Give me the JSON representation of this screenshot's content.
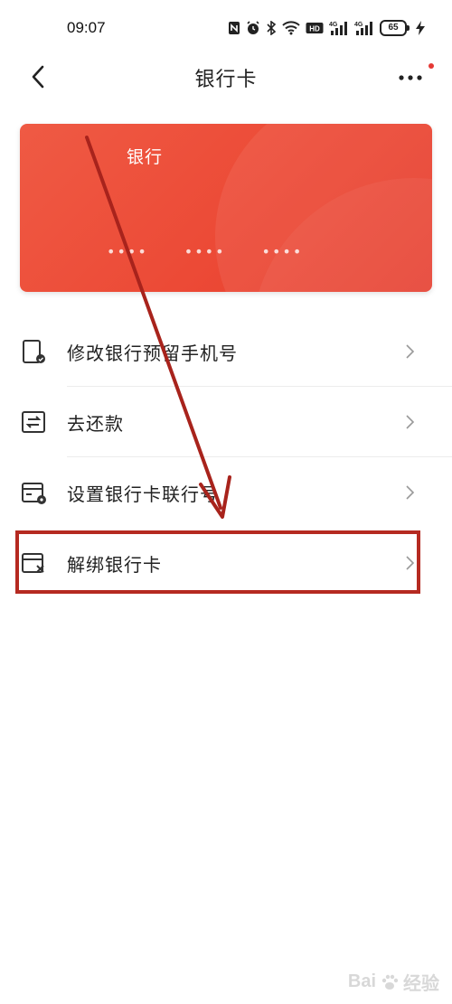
{
  "status_bar": {
    "time": "09:07",
    "network_1": "4G",
    "network_2": "4G",
    "hd_label": "HD",
    "battery": "65",
    "icons": [
      "nfc-icon",
      "alarm-icon",
      "bluetooth-icon",
      "wifi-icon",
      "hd-icon",
      "signal-icon",
      "signal-icon",
      "battery-icon",
      "charging-icon"
    ]
  },
  "nav": {
    "title": "银行卡",
    "back_icon": "chevron-left-icon",
    "more_icon": "more-icon",
    "notification_dot_color": "#e53935"
  },
  "card": {
    "bank_name": "银行",
    "number_groups": [
      "••••",
      "••••",
      "••••"
    ],
    "color_start": "#ef5a44",
    "color_end": "#e63b2c"
  },
  "menu": {
    "items": [
      {
        "label": "修改银行预留手机号",
        "icon": "phone-edit-icon"
      },
      {
        "label": "去还款",
        "icon": "repay-icon"
      },
      {
        "label": "设置银行卡联行号",
        "icon": "card-settings-icon"
      },
      {
        "label": "解绑银行卡",
        "icon": "card-unbind-icon"
      }
    ]
  },
  "annotation": {
    "highlight_color": "#b52a21",
    "arrow_color": "#a8231c"
  },
  "watermark": {
    "text": "Bai",
    "text_2": "经验"
  }
}
